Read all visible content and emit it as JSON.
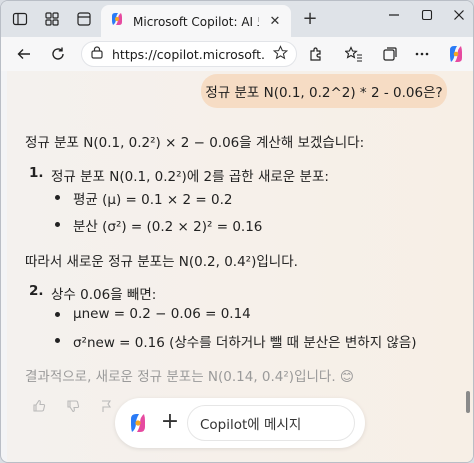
{
  "tab": {
    "title": "Microsoft Copilot: AI 도우미",
    "close": "✕"
  },
  "toolbar": {
    "new_tab": "+",
    "url": "https://copilot.microsoft.c..."
  },
  "chat": {
    "user_message": "정규 분포 N(0.1, 0.2^2) * 2 - 0.06은?",
    "intro": "정규 분포 N(0.1, 0.2²) × 2 − 0.06을 계산해 보겠습니다:",
    "step1": {
      "num": "1.",
      "title": "정규 분포 N(0.1, 0.2²)에 2를 곱한 새로운 분포:",
      "bullets": [
        "평균 (μ) = 0.1 × 2 = 0.2",
        "분산 (σ²) = (0.2 × 2)² = 0.16"
      ]
    },
    "middle": "따라서 새로운 정규 분포는 N(0.2, 0.4²)입니다.",
    "step2": {
      "num": "2.",
      "title": "상수 0.06을 빼면:",
      "bullets": [
        "μnew = 0.2 − 0.06 = 0.14",
        "σ²new = 0.16 (상수를 더하거나 뺄 때 분산은 변하지 않음)"
      ]
    },
    "conclusion": "결과적으로, 새로운 정규 분포는 N(0.14, 0.4²)입니다. 😊"
  },
  "composer": {
    "plus": "+",
    "placeholder": "Copilot에 메시지"
  },
  "colors": {
    "user_bubble": "#f6dcc4",
    "page_bg": "#f4f1ee",
    "accent": "#7b5cff"
  },
  "icons": [
    "sidebar-icon",
    "workspaces-icon",
    "tab-actions-icon",
    "back-icon",
    "refresh-icon",
    "site-info-icon",
    "favorite-icon",
    "extensions-icon",
    "favorites-icon",
    "collections-icon",
    "copilot-icon"
  ]
}
